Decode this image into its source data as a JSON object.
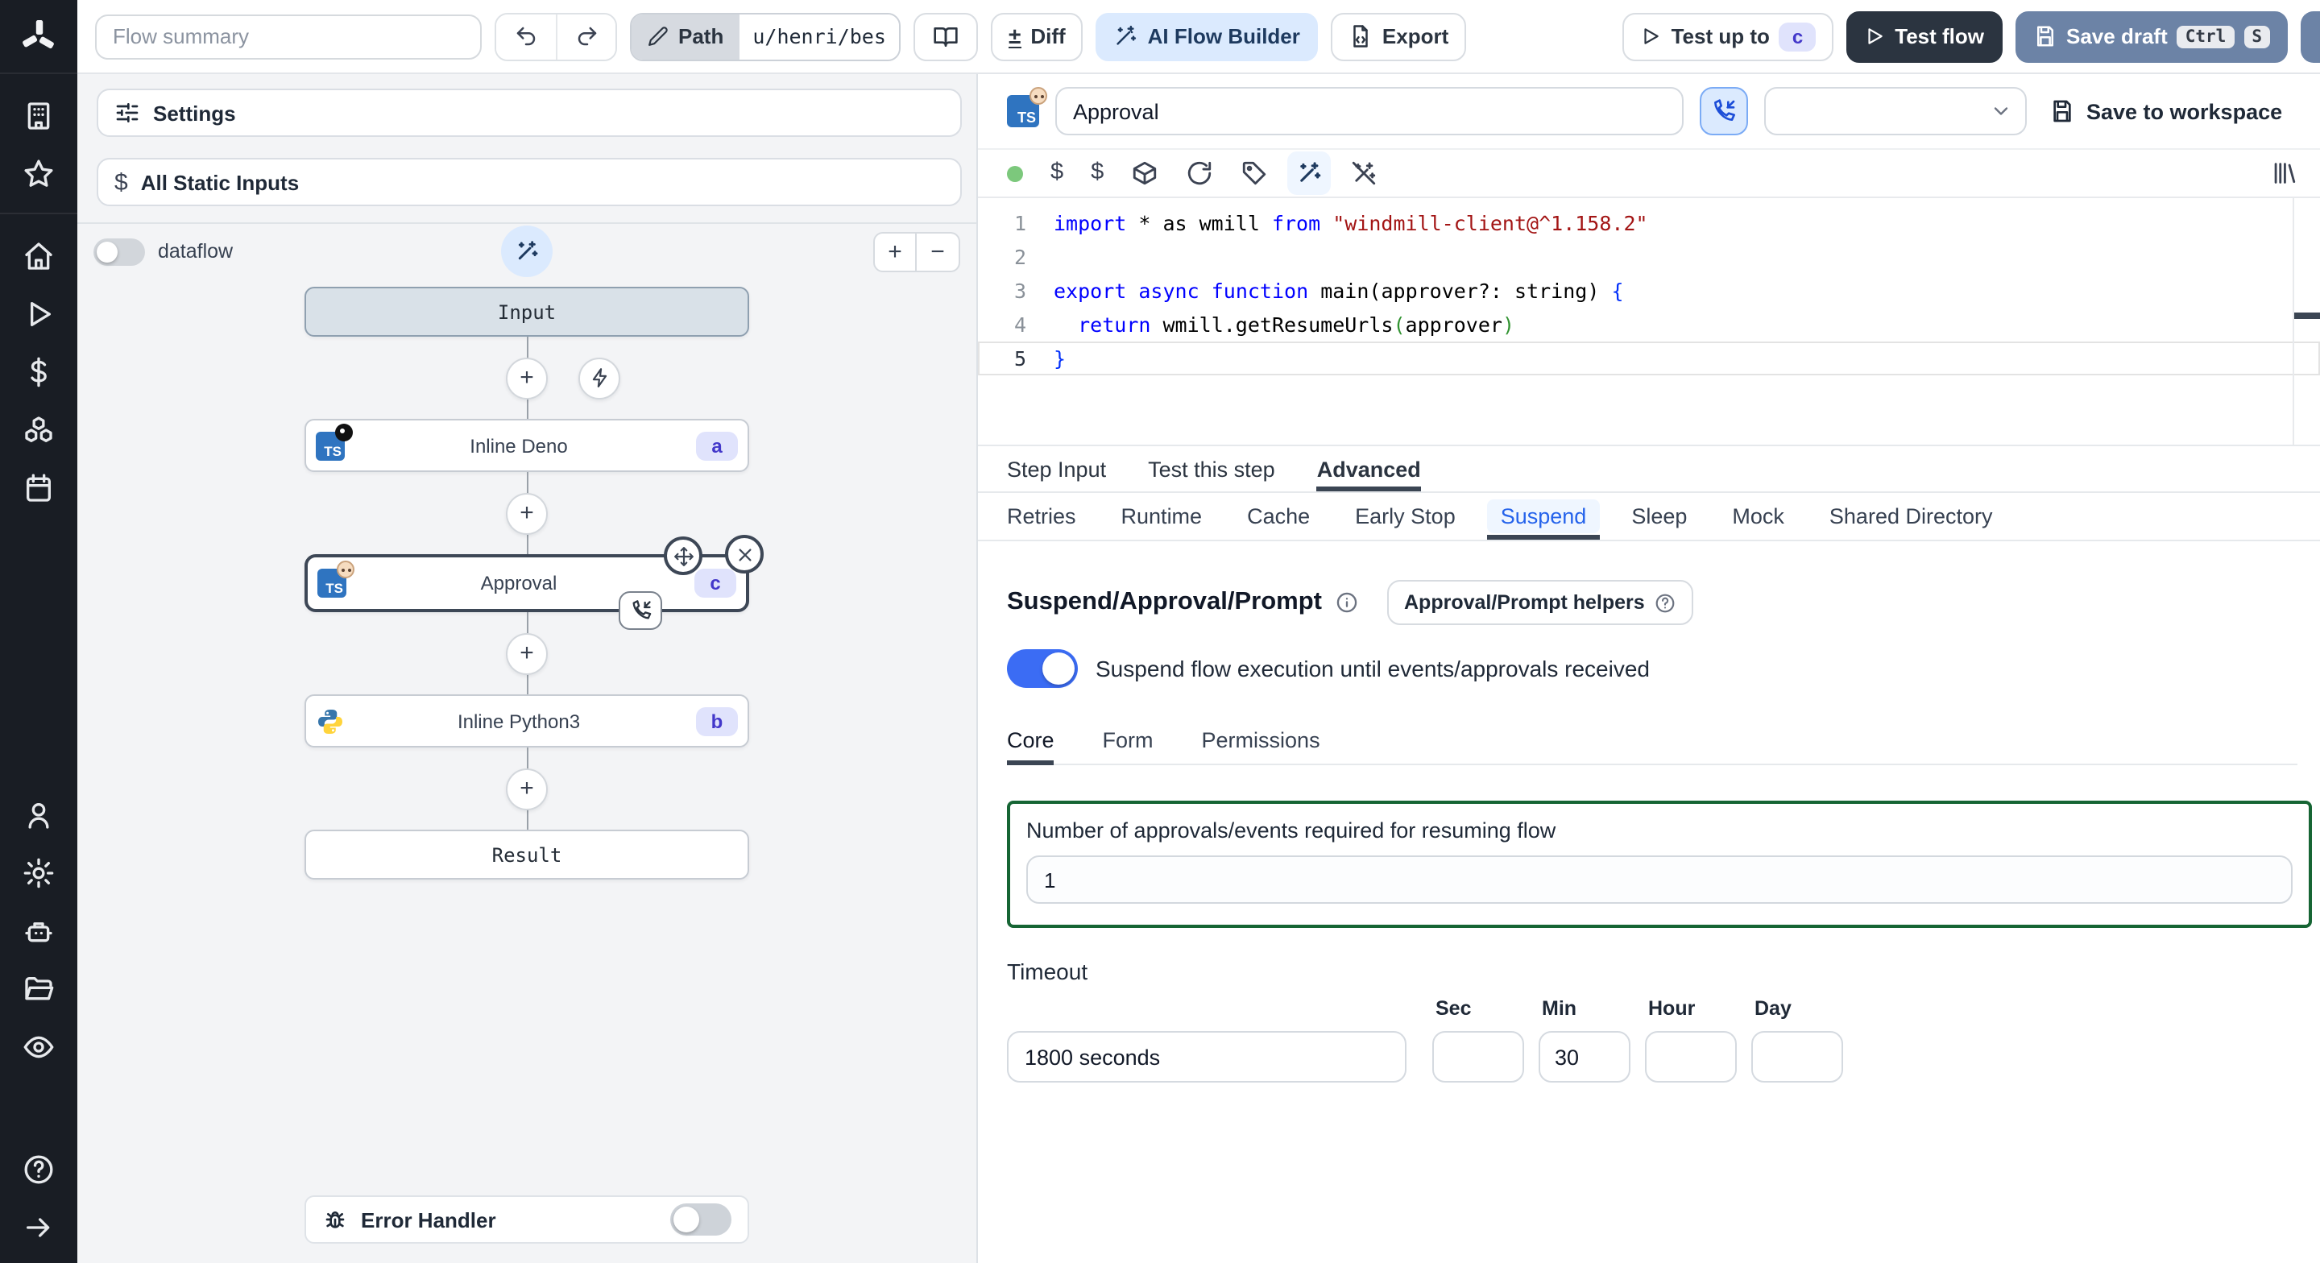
{
  "topbar": {
    "flow_summary_placeholder": "Flow summary",
    "path_label": "Path",
    "path_value": "u/henri/bes",
    "diff_label": "Diff",
    "diff_glyph": "±",
    "ai_flow_builder_label": "AI Flow Builder",
    "export_label": "Export",
    "test_up_to_label": "Test up to",
    "test_up_to_badge": "c",
    "test_flow_label": "Test flow",
    "save_draft_label": "Save draft",
    "save_draft_kbd_1": "Ctrl",
    "save_draft_kbd_2": "S"
  },
  "sidebar": {
    "icons": [
      "windmill-logo",
      "building",
      "star",
      "home",
      "play",
      "dollar",
      "boxes",
      "calendar",
      "user",
      "settings",
      "robot",
      "folder",
      "eye",
      "help-circle",
      "arrow-right"
    ]
  },
  "flow_panel": {
    "settings_label": "Settings",
    "static_inputs_label": "All Static Inputs",
    "dataflow_label": "dataflow",
    "zoom_in_glyph": "+",
    "zoom_out_glyph": "−",
    "graph": {
      "input_label": "Input",
      "deno_node": {
        "label": "Inline Deno",
        "badge": "a",
        "icon": "typescript-deno"
      },
      "approval_node": {
        "label": "Approval",
        "badge": "c",
        "icon": "typescript-baby"
      },
      "python_node": {
        "label": "Inline Python3",
        "badge": "b",
        "icon": "python"
      },
      "result_label": "Result"
    },
    "error_handler_label": "Error Handler"
  },
  "step_header": {
    "name_value": "Approval",
    "save_to_workspace_label": "Save to workspace",
    "toolbar_icons": [
      "status-dot",
      "dollar",
      "dollar",
      "package",
      "refresh",
      "tag",
      "wand",
      "wand-off",
      "library"
    ]
  },
  "editor": {
    "lines": [
      {
        "n": "1",
        "tokens": [
          [
            "kw",
            "import"
          ],
          [
            "pl",
            " * as wmill "
          ],
          [
            "kw",
            "from"
          ],
          [
            "pl",
            " "
          ],
          [
            "str",
            "\"windmill-client@^1.158.2\""
          ]
        ]
      },
      {
        "n": "2",
        "tokens": []
      },
      {
        "n": "3",
        "tokens": [
          [
            "kw",
            "export"
          ],
          [
            "pl",
            " "
          ],
          [
            "kw",
            "async"
          ],
          [
            "pl",
            " "
          ],
          [
            "kw",
            "function"
          ],
          [
            "pl",
            " main(approver?: string) "
          ],
          [
            "pblue",
            "{"
          ]
        ]
      },
      {
        "n": "4",
        "tokens": [
          [
            "pl",
            "  "
          ],
          [
            "kw",
            "return"
          ],
          [
            "pl",
            " wmill.getResumeUrls"
          ],
          [
            "pgreen",
            "("
          ],
          [
            "pl",
            "approver"
          ],
          [
            "pgreen",
            ")"
          ]
        ]
      },
      {
        "n": "5",
        "tokens": [
          [
            "pblue",
            "}"
          ]
        ],
        "current": true
      }
    ]
  },
  "step_tabs": {
    "items": [
      {
        "label": "Step Input"
      },
      {
        "label": "Test this step"
      },
      {
        "label": "Advanced"
      }
    ]
  },
  "advanced_tabs": {
    "items": [
      {
        "label": "Retries"
      },
      {
        "label": "Runtime"
      },
      {
        "label": "Cache"
      },
      {
        "label": "Early Stop"
      },
      {
        "label": "Suspend"
      },
      {
        "label": "Sleep"
      },
      {
        "label": "Mock"
      },
      {
        "label": "Shared Directory"
      }
    ]
  },
  "suspend": {
    "title": "Suspend/Approval/Prompt",
    "helpers_label": "Approval/Prompt helpers",
    "toggle_label": "Suspend flow execution until events/approvals received",
    "inner_tabs": {
      "items": [
        {
          "label": "Core"
        },
        {
          "label": "Form"
        },
        {
          "label": "Permissions"
        }
      ]
    },
    "approvals_label": "Number of approvals/events required for resuming flow",
    "approvals_value": "1",
    "timeout_label": "Timeout",
    "timeout_value": "1800 seconds",
    "units": [
      {
        "label": "Sec",
        "value": ""
      },
      {
        "label": "Min",
        "value": "30"
      },
      {
        "label": "Hour",
        "value": ""
      },
      {
        "label": "Day",
        "value": ""
      }
    ]
  },
  "colors": {
    "accent_blue": "#3b82f6",
    "ai_button_bg": "#dbeafe",
    "dark_button_bg": "#2b3440",
    "save_draft_bg": "#6c83a6",
    "badge_indigo_text": "#4338ca",
    "badge_indigo_bg": "#e0e3fc",
    "suspend_green_border": "#166534",
    "toggle_on_blue": "#3b6cf4",
    "rail_bg": "#191d24"
  }
}
